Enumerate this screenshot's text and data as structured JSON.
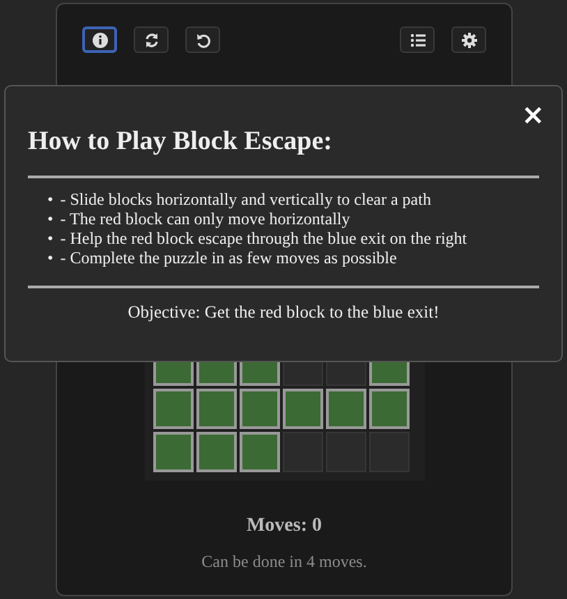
{
  "toolbar": {
    "left": [
      {
        "selected": true
      },
      {
        "selected": false
      },
      {
        "selected": false
      }
    ],
    "right": [
      {
        "selected": false
      },
      {
        "selected": false
      }
    ]
  },
  "board": {
    "rows": [
      {
        "cells": [
          {
            "kind": "block"
          },
          {
            "kind": "block"
          },
          {
            "kind": "block"
          },
          {
            "kind": "empty"
          },
          {
            "kind": "empty"
          },
          {
            "kind": "block"
          }
        ]
      },
      {
        "cells": [
          {
            "kind": "block"
          },
          {
            "kind": "block"
          },
          {
            "kind": "block"
          },
          {
            "kind": "block"
          },
          {
            "kind": "block"
          },
          {
            "kind": "block"
          }
        ]
      },
      {
        "cells": [
          {
            "kind": "block"
          },
          {
            "kind": "block"
          },
          {
            "kind": "block"
          },
          {
            "kind": "empty"
          },
          {
            "kind": "empty"
          },
          {
            "kind": "empty"
          }
        ]
      }
    ]
  },
  "moves": "Moves: 0",
  "hint": "Can be done in 4 moves.",
  "modal": {
    "close": "×",
    "title": "How to Play Block Escape:",
    "rules": [
      {
        "bullet": "•",
        "text": "- Slide blocks horizontally and vertically to clear a path"
      },
      {
        "bullet": "•",
        "text": "- The red block can only move horizontally"
      },
      {
        "bullet": "•",
        "text": "- Help the red block escape through the blue exit on the right"
      },
      {
        "bullet": "•",
        "text": "- Complete the puzzle in as few moves as possible"
      }
    ],
    "objective": "Objective: Get the red block to the blue exit!"
  }
}
